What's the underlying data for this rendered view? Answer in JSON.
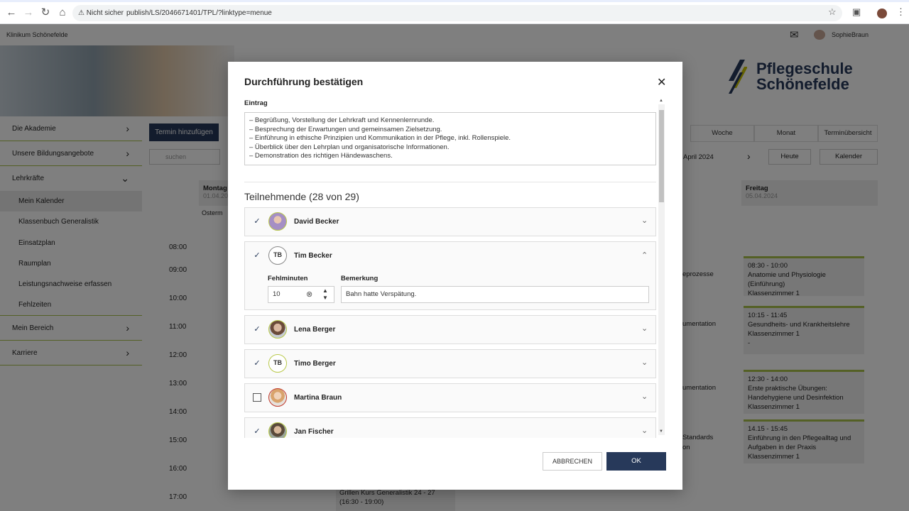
{
  "browser": {
    "security_label": "Nicht sicher",
    "url": "publish/LS/2046671401/TPL/?linktype=menue"
  },
  "topbar": {
    "brand": "Klinikum Schönefelde",
    "user": "SophieBraun"
  },
  "hero": {
    "logo_line1": "Pflegeschule",
    "logo_line2": "Schönefelde"
  },
  "sidebar": {
    "items": [
      {
        "label": "Die Akademie"
      },
      {
        "label": "Unsere Bildungsangebote"
      },
      {
        "label": "Lehrkräfte"
      },
      {
        "label": "Mein Bereich"
      },
      {
        "label": "Karriere"
      }
    ],
    "subitems": [
      {
        "label": "Mein Kalender"
      },
      {
        "label": "Klassenbuch Generalistik"
      },
      {
        "label": "Einsatzplan"
      },
      {
        "label": "Raumplan"
      },
      {
        "label": "Leistungsnachweise erfassen"
      },
      {
        "label": "Fehlzeiten"
      }
    ]
  },
  "calendar": {
    "add_button": "Termin hinzufügen",
    "search_placeholder": "suchen",
    "views": [
      "Woche",
      "Monat",
      "Terminübersicht"
    ],
    "month_label": "April 2024",
    "today_button": "Heute",
    "calendar_button": "Kalender",
    "day_monday": "Montag",
    "day_monday_date": "01.04.20",
    "holiday": "Osterm",
    "day_friday": "Freitag",
    "day_friday_date": "05.04.2024",
    "times": [
      "08:00",
      "09:00",
      "10:00",
      "11:00",
      "12:00",
      "13:00",
      "14:00",
      "15:00",
      "16:00",
      "17:00"
    ],
    "events": [
      {
        "time": "08:30 - 10:00",
        "title": "Anatomie und Physiologie (Einführung)",
        "room": "Klassenzimmer 1"
      },
      {
        "time": "10:15 - 11:45",
        "title": "Gesundheits- und Krankheitslehre",
        "room": "Klassenzimmer 1",
        "extra": "-"
      },
      {
        "time": "12:30 - 14:00",
        "title": "Erste praktische Übungen: Handehygiene und Desinfektion",
        "room": "Klassenzimmer 1"
      },
      {
        "time": "14.15 - 15:45",
        "title": "Einführung in den Pflegealltag und Aufgaben in der Praxis",
        "room": "Klassenzimmer 1"
      }
    ],
    "partial_events": [
      "eprozesse",
      "umentation",
      "umentation",
      "Standards",
      "on"
    ],
    "grill_event": "Grillen Kurs Generalistik 24 - 27",
    "grill_time": "(16:30 - 19:00)"
  },
  "modal": {
    "title": "Durchführung bestätigen",
    "entry_label": "Eintrag",
    "entry_lines": [
      "– Begrüßung, Vorstellung der Lehrkraft und Kennenlernrunde.",
      "– Besprechung der Erwartungen und gemeinsamen Zielsetzung.",
      "– Einführung in ethische Prinzipien und Kommunikation in der Pflege, inkl. Rollenspiele.",
      "– Überblick über den Lehrplan und organisatorische Informationen.",
      "– Demonstration des richtigen Händewaschens."
    ],
    "participants_title": "Teilnehmende (28 von 29)",
    "participants": [
      {
        "name": "David Becker",
        "initials": "",
        "checked": true
      },
      {
        "name": "Tim Becker",
        "initials": "TB",
        "checked": true
      },
      {
        "name": "Lena Berger",
        "initials": "",
        "checked": true
      },
      {
        "name": "Timo Berger",
        "initials": "TB",
        "checked": true
      },
      {
        "name": "Martina Braun",
        "initials": "",
        "checked": false
      },
      {
        "name": "Jan Fischer",
        "initials": "",
        "checked": true
      }
    ],
    "fehlminuten_label": "Fehlminuten",
    "fehlminuten_value": "10",
    "bemerkung_label": "Bemerkung",
    "bemerkung_value": "Bahn hatte Verspätung.",
    "cancel_label": "ABBRECHEN",
    "ok_label": "OK"
  }
}
